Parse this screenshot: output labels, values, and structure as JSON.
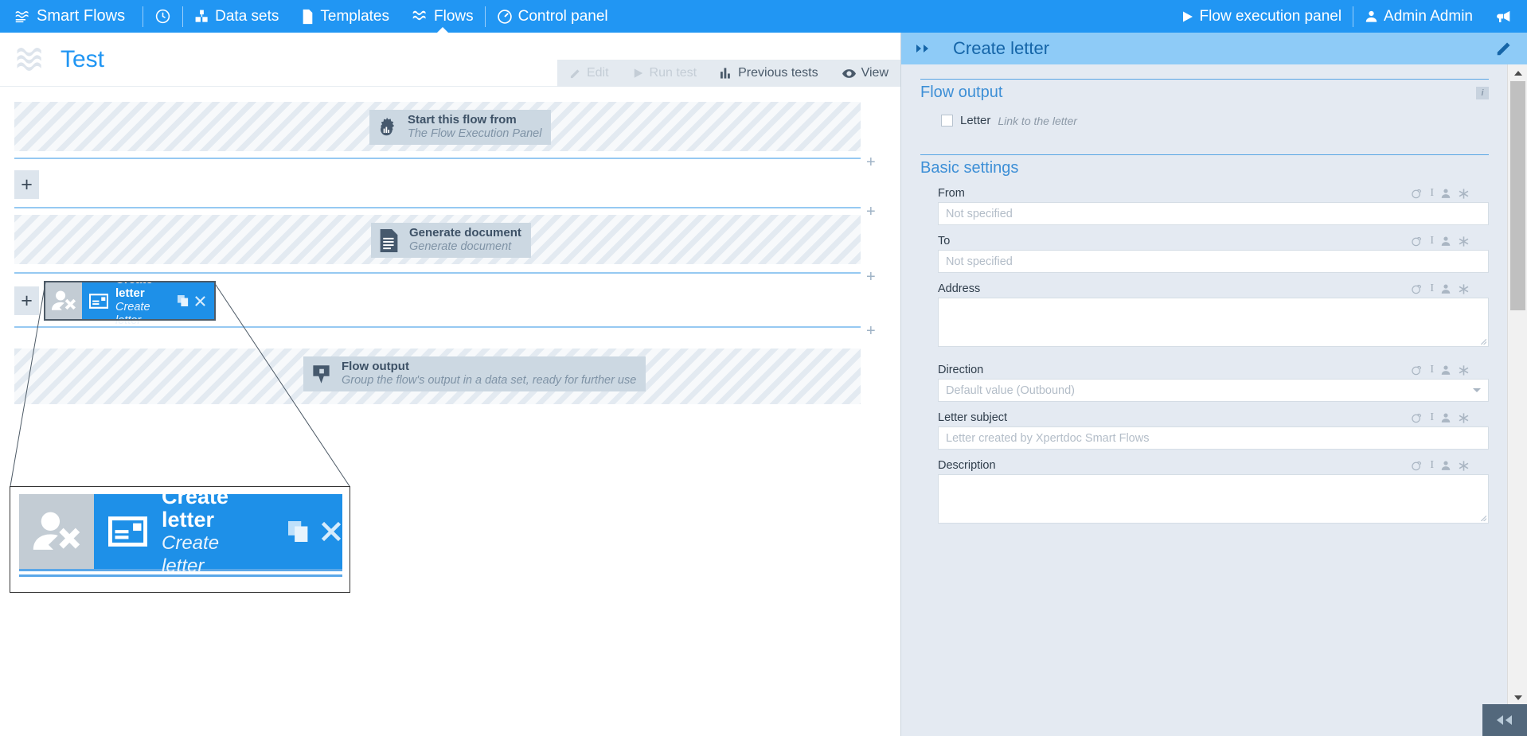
{
  "topnav": {
    "brand": "Smart Flows",
    "items": [
      {
        "label": "Data sets",
        "icon": "grid-icon",
        "active": false
      },
      {
        "label": "Templates",
        "icon": "document-icon",
        "active": false
      },
      {
        "label": "Flows",
        "icon": "waves-icon",
        "active": true
      },
      {
        "label": "Control panel",
        "icon": "gauge-icon",
        "active": false
      }
    ],
    "clock_icon": "clock-icon",
    "flow_execution_panel": "Flow execution panel",
    "user": "Admin Admin",
    "megaphone_icon": "megaphone-icon",
    "accent": "#2196f3"
  },
  "header": {
    "flow_icon": "waves-icon",
    "title": "Test",
    "toolbar": [
      {
        "label": "Edit",
        "icon": "pencil-icon",
        "enabled": false
      },
      {
        "label": "Run test",
        "icon": "play-icon",
        "enabled": false
      },
      {
        "label": "Previous tests",
        "icon": "bar-chart-icon",
        "enabled": true
      },
      {
        "label": "View",
        "icon": "eye-icon",
        "enabled": true
      }
    ]
  },
  "canvas": {
    "add_button_label": "+",
    "mini_add_label": "+",
    "nodes": [
      {
        "id": "start",
        "title": "Start this flow from",
        "subtitle": "The Flow Execution Panel",
        "icon": "gear-chart-icon"
      },
      {
        "id": "generate-document",
        "title": "Generate document",
        "subtitle": "Generate document",
        "icon": "document-lines-icon"
      },
      {
        "id": "create-letter",
        "title": "Create letter",
        "subtitle": "Create letter",
        "icon": "envelope-icon",
        "avatar_icon": "user-x-icon",
        "actions": [
          "copy-icon",
          "close-icon"
        ],
        "selected": true
      },
      {
        "id": "flow-output",
        "title": "Flow output",
        "subtitle": "Group the flow's output in a data set, ready for further use",
        "icon": "output-arrow-icon"
      }
    ],
    "magnified": {
      "title": "Create letter",
      "subtitle": "Create letter",
      "icon": "envelope-icon",
      "avatar_icon": "user-x-icon",
      "actions": [
        "copy-icon",
        "close-icon"
      ]
    }
  },
  "right_panel": {
    "collapse_icon": "double-chevron-right-icon",
    "title": "Create letter",
    "edit_icon": "pencil-icon",
    "sections": [
      {
        "id": "flow-output",
        "title": "Flow output",
        "info_icon": "info-icon",
        "checkbox": {
          "label": "Letter",
          "hint": "Link to the letter",
          "checked": false
        }
      },
      {
        "id": "basic-settings",
        "title": "Basic settings",
        "info_icon": null,
        "fields": [
          {
            "label": "From",
            "type": "text",
            "value": "",
            "placeholder": "Not specified"
          },
          {
            "label": "To",
            "type": "text",
            "value": "",
            "placeholder": "Not specified"
          },
          {
            "label": "Address",
            "type": "textarea",
            "value": "",
            "placeholder": ""
          },
          {
            "label": "Direction",
            "type": "select",
            "value": "Default value (Outbound)",
            "placeholder": "Default value (Outbound)"
          },
          {
            "label": "Letter subject",
            "type": "text",
            "value": "",
            "placeholder": "Letter created by Xpertdoc Smart Flows"
          },
          {
            "label": "Description",
            "type": "textarea",
            "value": "",
            "placeholder": ""
          }
        ]
      }
    ],
    "field_icons": [
      "link-icon",
      "italic-I-icon",
      "user-icon",
      "asterisk-icon"
    ],
    "scrollbar": {
      "up_icon": "triangle-up-icon",
      "down_icon": "triangle-down-icon"
    },
    "collapse_tab_icon": "double-chevron-left-icon"
  }
}
